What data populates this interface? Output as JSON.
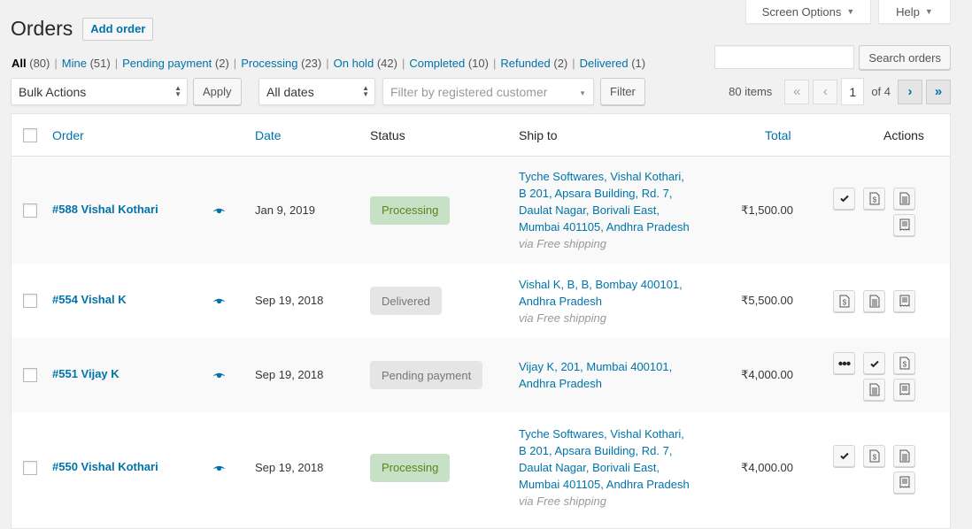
{
  "header": {
    "title": "Orders",
    "add_order_label": "Add order",
    "screen_options_label": "Screen Options",
    "help_label": "Help"
  },
  "views": [
    {
      "label": "All",
      "count": "(80)",
      "current": true
    },
    {
      "label": "Mine",
      "count": "(51)"
    },
    {
      "label": "Pending payment",
      "count": "(2)"
    },
    {
      "label": "Processing",
      "count": "(23)"
    },
    {
      "label": "On hold",
      "count": "(42)"
    },
    {
      "label": "Completed",
      "count": "(10)"
    },
    {
      "label": "Refunded",
      "count": "(2)"
    },
    {
      "label": "Delivered",
      "count": "(1)"
    }
  ],
  "search": {
    "value": "",
    "button_label": "Search orders"
  },
  "tablenav": {
    "bulk_actions": "Bulk Actions",
    "apply_label": "Apply",
    "dates": "All dates",
    "customer_placeholder": "Filter by registered customer",
    "filter_label": "Filter",
    "items_count": "80 items",
    "first_page": "«",
    "prev_page": "‹",
    "current_page": "1",
    "of_pages": "of 4",
    "next_page": "›",
    "last_page": "»"
  },
  "table": {
    "columns": {
      "order": "Order",
      "date": "Date",
      "status": "Status",
      "ship_to": "Ship to",
      "total": "Total",
      "actions": "Actions"
    },
    "rows": [
      {
        "order": "#588 Vishal Kothari",
        "date": "Jan 9, 2019",
        "status": "Processing",
        "ship_lines": [
          "Tyche Softwares, Vishal Kothari,",
          "B 201, Apsara Building, Rd. 7,",
          "Daulat Nagar, Borivali East,",
          "Mumbai 401105, Andhra Pradesh"
        ],
        "shipping_method": "via Free shipping",
        "total": "₹1,500.00",
        "actions": [
          "complete",
          "invoice",
          "document",
          "receipt"
        ]
      },
      {
        "order": "#554 Vishal K",
        "date": "Sep 19, 2018",
        "status": "Delivered",
        "ship_lines": [
          "Vishal K, B, B, Bombay 400101,",
          "Andhra Pradesh"
        ],
        "shipping_method": "via Free shipping",
        "total": "₹5,500.00",
        "actions": [
          "invoice",
          "document",
          "receipt"
        ]
      },
      {
        "order": "#551 Vijay K",
        "date": "Sep 19, 2018",
        "status": "Pending payment",
        "ship_lines": [
          "Vijay K, 201, Mumbai 400101,",
          "Andhra Pradesh"
        ],
        "shipping_method": "",
        "total": "₹4,000.00",
        "actions": [
          "processing",
          "complete",
          "invoice",
          "document",
          "receipt"
        ]
      },
      {
        "order": "#550 Vishal Kothari",
        "date": "Sep 19, 2018",
        "status": "Processing",
        "ship_lines": [
          "Tyche Softwares, Vishal Kothari,",
          "B 201, Apsara Building, Rd. 7,",
          "Daulat Nagar, Borivali East,",
          "Mumbai 401105, Andhra Pradesh"
        ],
        "shipping_method": "via Free shipping",
        "total": "₹4,000.00",
        "actions": [
          "complete",
          "invoice",
          "document",
          "receipt"
        ]
      }
    ]
  },
  "colors": {
    "link": "#0073aa",
    "processing_bg": "#c6e1c6",
    "processing_text": "#5b841b",
    "neutral_status_bg": "#e5e5e5"
  }
}
